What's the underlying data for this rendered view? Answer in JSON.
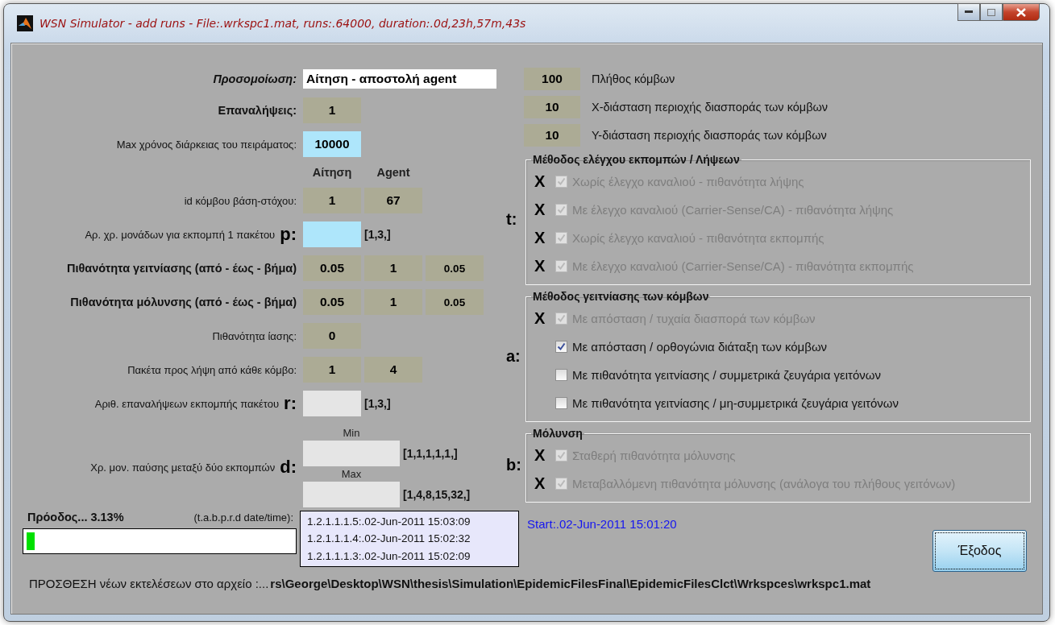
{
  "window": {
    "title": "WSN Simulator - add runs - File:.wrkspc1.mat, runs:.64000, duration:.0d,23h,57m,43s"
  },
  "rows": [
    {
      "kind": "text",
      "label": "Προσομοίωση:",
      "bold": true,
      "italic": true,
      "value": "Αίτηση - αποστολή agent"
    },
    {
      "kind": "fields",
      "label": "Επαναλήψεις:",
      "bold": true,
      "italic": false,
      "cells": [
        {
          "kind": "display",
          "value": "1"
        }
      ]
    },
    {
      "kind": "fields",
      "label": "Max χρόνος διάρκειας του πειράματος:",
      "bold": false,
      "italic": false,
      "cells": [
        {
          "kind": "input",
          "value": "10000"
        }
      ]
    },
    {
      "kind": "header",
      "labels": [
        "Αίτηση",
        "Agent"
      ]
    },
    {
      "kind": "fields",
      "label": "id κόμβου βάση-στόχου:",
      "bold": false,
      "italic": false,
      "cells": [
        {
          "kind": "display",
          "value": "1"
        },
        {
          "kind": "display",
          "value": "67"
        }
      ]
    },
    {
      "kind": "fields",
      "label": "Αρ. χρ. μονάδων για εκπομπή 1 πακέτου",
      "letter": "p:",
      "bold": false,
      "italic": false,
      "cells": [
        {
          "kind": "input"
        }
      ],
      "hint": "[1,3,]"
    },
    {
      "kind": "fields",
      "label": "Πιθανότητα γειτνίασης (από - έως - βήμα)",
      "bold": true,
      "italic": false,
      "cells": [
        {
          "kind": "display",
          "value": "0.05"
        },
        {
          "kind": "display",
          "value": "1"
        },
        {
          "kind": "display",
          "value": "0.05",
          "small": true
        }
      ]
    },
    {
      "kind": "fields",
      "label": "Πιθανότητα μόλυνσης (από - έως - βήμα)",
      "bold": true,
      "italic": false,
      "cells": [
        {
          "kind": "display",
          "value": "0.05"
        },
        {
          "kind": "display",
          "value": "1"
        },
        {
          "kind": "display",
          "value": "0.05",
          "small": true
        }
      ]
    },
    {
      "kind": "fields",
      "label": "Πιθανότητα ίασης:",
      "bold": false,
      "italic": false,
      "cells": [
        {
          "kind": "display",
          "value": "0"
        }
      ]
    },
    {
      "kind": "fields",
      "label": "Πακέτα προς λήψη από κάθε κόμβο:",
      "bold": false,
      "italic": false,
      "cells": [
        {
          "kind": "display",
          "value": "1"
        },
        {
          "kind": "display",
          "value": "4"
        }
      ]
    },
    {
      "kind": "fields",
      "label": "Αριθ. επαναλήψεων εκπομπής πακέτου",
      "letter": "r:",
      "bold": false,
      "italic": false,
      "cells": [
        {
          "kind": "blank"
        }
      ],
      "hint": "[1,3,]"
    },
    {
      "kind": "range",
      "label": "Χρ. μον. παύσης μεταξύ δύο εκπομπών",
      "letter": "d:",
      "bold": false,
      "italic": false,
      "bounds": [
        {
          "caption": "Min",
          "hint": "[1,1,1,1,1,]"
        },
        {
          "caption": "Max",
          "hint": "[1,4,8,15,32,]"
        }
      ]
    }
  ],
  "params": [
    {
      "value": "100",
      "label": "Πλήθος κόμβων"
    },
    {
      "value": "10",
      "label": "X-διάσταση περιοχής διασποράς των κόμβων"
    },
    {
      "value": "10",
      "label": "Y-διάσταση περιοχής διασποράς των κόμβων"
    }
  ],
  "groups": [
    {
      "letter": "t:",
      "title": "Μέθοδος ελέγχου εκπομπών / Λήψεων",
      "options": [
        {
          "marker": "X",
          "checked": true,
          "disabled": true,
          "label": "Χωρίς έλεγχο καναλιού - πιθανότητα λήψης"
        },
        {
          "marker": "X",
          "checked": true,
          "disabled": true,
          "label": "Με έλεγχο καναλιού (Carrier-Sense/CA) - πιθανότητα λήψης"
        },
        {
          "marker": "X",
          "checked": true,
          "disabled": true,
          "label": "Χωρίς έλεγχο καναλιού - πιθανότητα εκπομπής"
        },
        {
          "marker": "X",
          "checked": true,
          "disabled": true,
          "label": "Με έλεγχο καναλιού (Carrier-Sense/CA) - πιθανότητα εκπομπής"
        }
      ]
    },
    {
      "letter": "a:",
      "title": "Μέθοδος γειτνίασης των κόμβων",
      "options": [
        {
          "marker": "X",
          "checked": true,
          "disabled": true,
          "label": "Με απόσταση / τυχαία διασπορά των κόμβων"
        },
        {
          "checked": true,
          "disabled": false,
          "label": "Με απόσταση / ορθογώνια διάταξη των κόμβων"
        },
        {
          "checked": false,
          "disabled": false,
          "label": "Με πιθανότητα γειτνίασης / συμμετρικά ζευγάρια γειτόνων"
        },
        {
          "checked": false,
          "disabled": false,
          "label": "Με πιθανότητα γειτνίασης / μη-συμμετρικά ζευγάρια γειτόνων"
        }
      ]
    },
    {
      "letter": "b:",
      "title": "Μόλυνση",
      "options": [
        {
          "marker": "X",
          "checked": true,
          "disabled": true,
          "label": "Σταθερή πιθανότητα μόλυνσης"
        },
        {
          "marker": "X",
          "checked": true,
          "disabled": true,
          "label": "Μεταβαλλόμενη πιθανότητα μόλυνσης (ανάλογα του πλήθους γειτόνων)"
        }
      ]
    }
  ],
  "progress": {
    "label": "Πρόοδος... 3.13%",
    "level": 0.0313,
    "log_label": "(t.a.b.p.r.d  date/time):"
  },
  "log": [
    "1.2.1.1.1.5:.02-Jun-2011 15:03:09",
    "1.2.1.1.1.4:.02-Jun-2011 15:02:32",
    "1.2.1.1.1.3:.02-Jun-2011 15:02:09"
  ],
  "start": "Start:.02-Jun-2011 15:01:20",
  "exit_button": "Έξοδος",
  "status": {
    "label": "ΠΡΟΣΘΕΣΗ νέων εκτελέσεων στο αρχείο :...",
    "path": "rs\\George\\Desktop\\WSN\\thesis\\Simulation\\EpidemicFilesFinal\\EpidemicFilesClct\\Wrkspces\\wrkspc1.mat"
  }
}
